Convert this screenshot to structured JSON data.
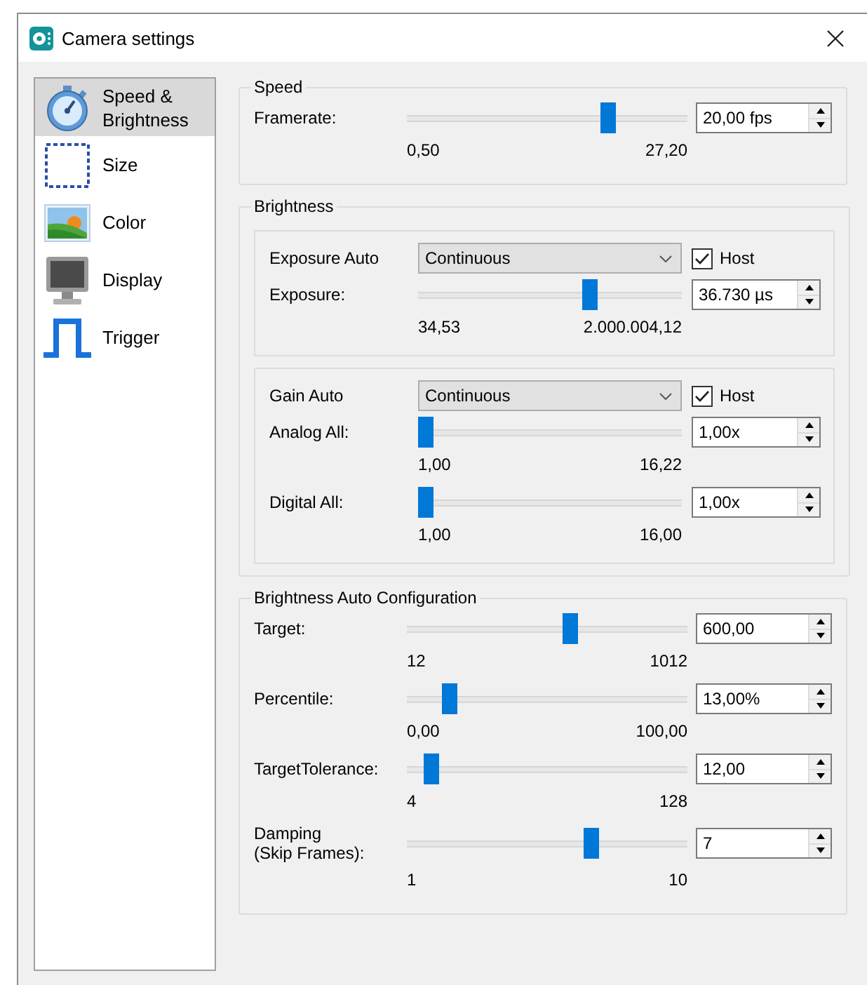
{
  "window": {
    "title": "Camera settings"
  },
  "sidebar": {
    "items": [
      {
        "label": "Speed &\nBrightness",
        "selected": true
      },
      {
        "label": "Size",
        "selected": false
      },
      {
        "label": "Color",
        "selected": false
      },
      {
        "label": "Display",
        "selected": false
      },
      {
        "label": "Trigger",
        "selected": false
      }
    ]
  },
  "sections": [
    {
      "title": "Speed",
      "rows": [
        {
          "kind": "slider",
          "label": "Framerate:",
          "level": 0.73,
          "min": "0,50",
          "max": "27,20",
          "value": "20,00 fps"
        }
      ]
    },
    {
      "title": "Brightness",
      "subpanels": [
        {
          "rows": [
            {
              "kind": "dropdown",
              "label": "Exposure Auto",
              "value": "Continuous",
              "checkbox": {
                "label": "Host",
                "checked": true
              }
            },
            {
              "kind": "slider",
              "label": "Exposure:",
              "level": 0.66,
              "min": "34,53",
              "max": "2.000.004,12",
              "value": "36.730 µs"
            }
          ]
        },
        {
          "rows": [
            {
              "kind": "dropdown",
              "label": "Gain Auto",
              "value": "Continuous",
              "checkbox": {
                "label": "Host",
                "checked": true
              }
            },
            {
              "kind": "slider",
              "label": "Analog All:",
              "level": 0,
              "min": "1,00",
              "max": "16,22",
              "value": "1,00x"
            },
            {
              "kind": "slider",
              "label": "Digital All:",
              "level": 0,
              "min": "1,00",
              "max": "16,00",
              "value": "1,00x"
            }
          ]
        }
      ]
    },
    {
      "title": "Brightness Auto Configuration",
      "rows": [
        {
          "kind": "slider",
          "label": "Target:",
          "level": 0.588,
          "min": "12",
          "max": "1012",
          "value": "600,00"
        },
        {
          "kind": "slider",
          "label": "Percentile:",
          "level": 0.13,
          "min": "0,00",
          "max": "100,00",
          "value": "13,00%"
        },
        {
          "kind": "slider",
          "label": "TargetTolerance:",
          "level": 0.065,
          "min": "4",
          "max": "128",
          "value": "12,00"
        },
        {
          "kind": "slider",
          "label": "Damping\n(Skip Frames):",
          "level": 0.667,
          "min": "1",
          "max": "10",
          "value": "7"
        }
      ]
    }
  ]
}
